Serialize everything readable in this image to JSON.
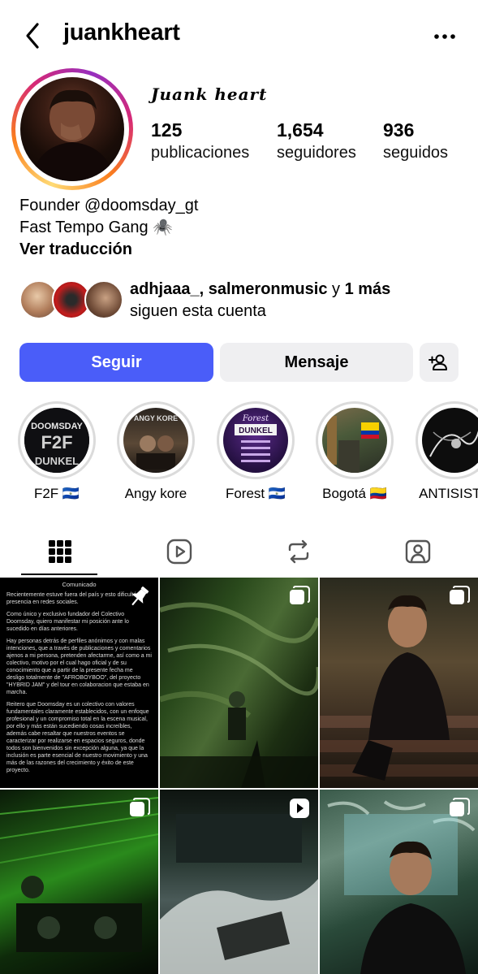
{
  "header": {
    "username": "juankheart"
  },
  "profile": {
    "display_name": "Juank heart",
    "stats": [
      {
        "value": "125",
        "label": "publicaciones"
      },
      {
        "value": "1,654",
        "label": "seguidores"
      },
      {
        "value": "936",
        "label": "seguidos"
      }
    ],
    "bio_lines": [
      "Founder @doomsday_gt",
      "Fast Tempo Gang 🕷️"
    ],
    "translate_label": "Ver traducción"
  },
  "mutual": {
    "names": "adhjaaa_, salmeronmusic",
    "connector": " y ",
    "more": "1 más",
    "subtitle": "siguen esta cuenta"
  },
  "actions": {
    "follow_label": "Seguir",
    "message_label": "Mensaje"
  },
  "highlights": [
    {
      "label": "F2F 🇸🇻",
      "art": "DOOMSDAY F2F DUNKEL"
    },
    {
      "label": "Angy kore",
      "art": "ANGY KORE"
    },
    {
      "label": "Forest 🇸🇻",
      "art": "Forest DUNKEL"
    },
    {
      "label": "Bogotá 🇨🇴",
      "art": ""
    },
    {
      "label": "ANTISISTE",
      "art": ""
    }
  ],
  "tabs": [
    "grid",
    "reels",
    "reposts",
    "tagged"
  ],
  "posts": {
    "pinned_doc": {
      "title": "Comunicado",
      "paragraphs": [
        "Recientemente estuve fuera del país y esto dificultó mi presencia en redes sociales.",
        "Como único y exclusivo fundador del Colectivo Doomsday, quiero manifestar mi posición ante lo sucedido en días anteriores.",
        "Hay personas detrás de perfiles anónimos y con malas intenciones, que a través de publicaciones y comentarios ajenos a mi persona, pretenden afectarme, así como a mi colectivo, motivo por el cual hago oficial y de su conocimiento que a partir de la presente fecha me desligo totalmente de \"AFROBOYBOO\", del proyecto \"HYBRID JAM\" y del tour en colaboracion que estaba en marcha.",
        "Reitero que Doomsday es un colectivo con valores fundamentales claramente establecidos, con un enfoque profesional y un compromiso total en la escena musical, por ello y más están sucediendo cosas increíbles, además cabe resaltar que nuestros eventos se caracterizar por realizarse en espacios seguros, donde todos son bienvenidos sin excepción alguna, ya que la inclusión es parte esencial de nuestro movimiento y una más de las razones del crecimiento y éxito de este proyecto."
      ]
    }
  },
  "colors": {
    "follow_button": "#4a5df9",
    "secondary_button": "#efeff1",
    "ring_gradient": [
      "#feda75",
      "#fa7e1e",
      "#d62976",
      "#962fbf"
    ]
  }
}
